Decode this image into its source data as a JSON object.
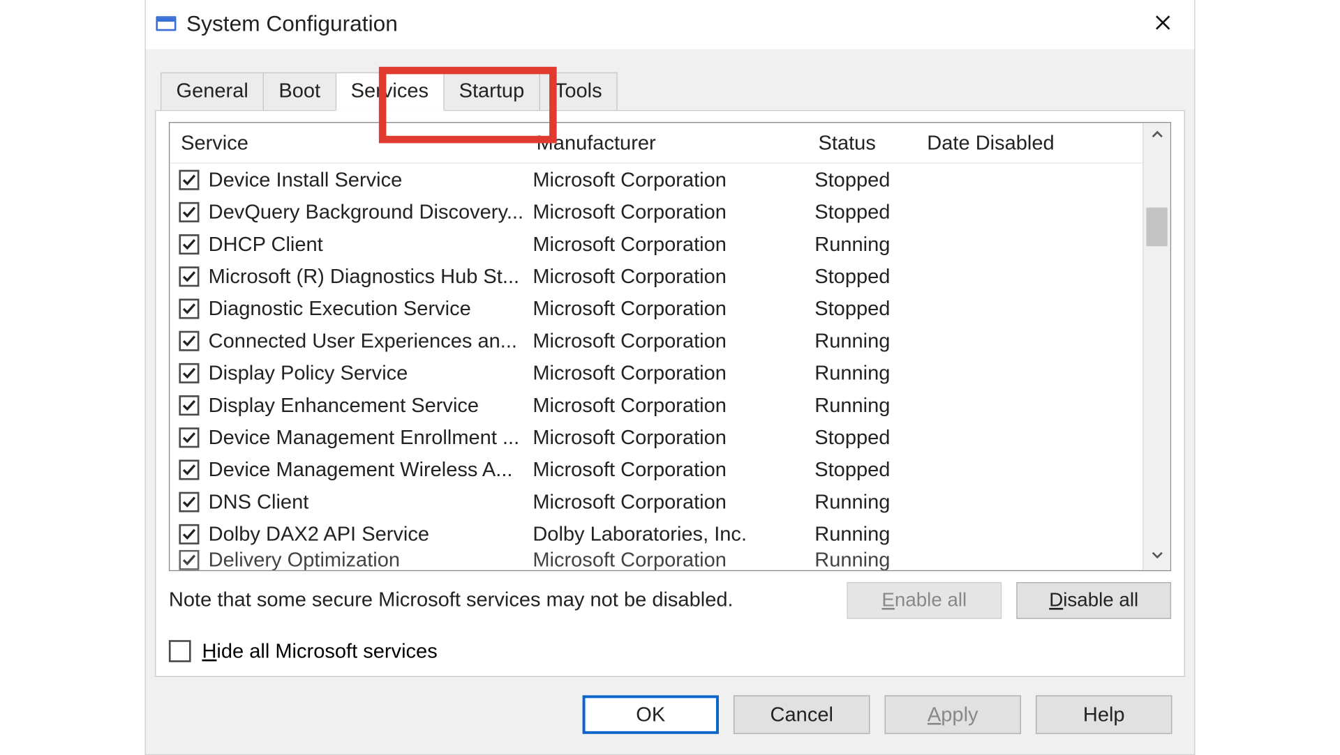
{
  "window": {
    "title": "System Configuration"
  },
  "tabs": {
    "general": "General",
    "boot": "Boot",
    "services": "Services",
    "startup": "Startup",
    "tools": "Tools",
    "active": "services"
  },
  "columns": {
    "service": "Service",
    "manufacturer": "Manufacturer",
    "status": "Status",
    "date_disabled": "Date Disabled"
  },
  "services": [
    {
      "checked": true,
      "name": "Device Install Service",
      "manufacturer": "Microsoft Corporation",
      "status": "Stopped",
      "date_disabled": ""
    },
    {
      "checked": true,
      "name": "DevQuery Background Discovery...",
      "manufacturer": "Microsoft Corporation",
      "status": "Stopped",
      "date_disabled": ""
    },
    {
      "checked": true,
      "name": "DHCP Client",
      "manufacturer": "Microsoft Corporation",
      "status": "Running",
      "date_disabled": ""
    },
    {
      "checked": true,
      "name": "Microsoft (R) Diagnostics Hub St...",
      "manufacturer": "Microsoft Corporation",
      "status": "Stopped",
      "date_disabled": ""
    },
    {
      "checked": true,
      "name": "Diagnostic Execution Service",
      "manufacturer": "Microsoft Corporation",
      "status": "Stopped",
      "date_disabled": ""
    },
    {
      "checked": true,
      "name": "Connected User Experiences an...",
      "manufacturer": "Microsoft Corporation",
      "status": "Running",
      "date_disabled": ""
    },
    {
      "checked": true,
      "name": "Display Policy Service",
      "manufacturer": "Microsoft Corporation",
      "status": "Running",
      "date_disabled": ""
    },
    {
      "checked": true,
      "name": "Display Enhancement Service",
      "manufacturer": "Microsoft Corporation",
      "status": "Running",
      "date_disabled": ""
    },
    {
      "checked": true,
      "name": "Device Management Enrollment ...",
      "manufacturer": "Microsoft Corporation",
      "status": "Stopped",
      "date_disabled": ""
    },
    {
      "checked": true,
      "name": "Device Management Wireless A...",
      "manufacturer": "Microsoft Corporation",
      "status": "Stopped",
      "date_disabled": ""
    },
    {
      "checked": true,
      "name": "DNS Client",
      "manufacturer": "Microsoft Corporation",
      "status": "Running",
      "date_disabled": ""
    },
    {
      "checked": true,
      "name": "Dolby DAX2 API Service",
      "manufacturer": "Dolby Laboratories, Inc.",
      "status": "Running",
      "date_disabled": ""
    },
    {
      "checked": true,
      "name": "Delivery Optimization",
      "manufacturer": "Microsoft Corporation",
      "status": "Running",
      "date_disabled": "",
      "partial": true
    }
  ],
  "note": "Note that some secure Microsoft services may not be disabled.",
  "buttons": {
    "enable_all": "Enable all",
    "disable_all": "Disable all",
    "enable_all_disabled": true
  },
  "hide_ms": {
    "label": "Hide all Microsoft services",
    "checked": false
  },
  "dialog_buttons": {
    "ok": "OK",
    "cancel": "Cancel",
    "apply": "Apply",
    "help": "Help",
    "apply_disabled": true
  }
}
